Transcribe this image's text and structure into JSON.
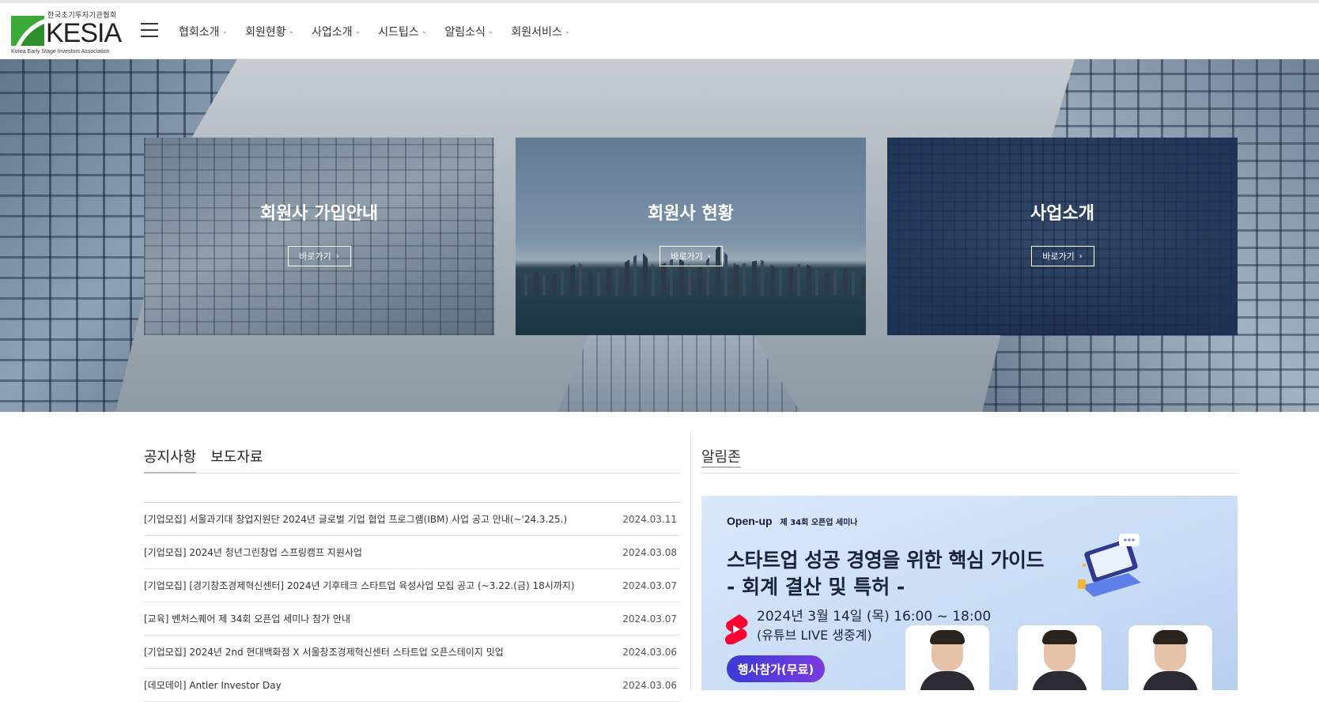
{
  "header": {
    "logo_kor": "한국초기투자기관협회",
    "logo_word": "KESIA",
    "logo_eng": "Korea Early Stage Investors Association",
    "nav": [
      {
        "label": "협회소개"
      },
      {
        "label": "회원현황"
      },
      {
        "label": "사업소개"
      },
      {
        "label": "시드팁스"
      },
      {
        "label": "알림소식"
      },
      {
        "label": "회원서비스"
      }
    ]
  },
  "hero": {
    "cards": [
      {
        "title": "회원사 가입안내",
        "button": "바로가기"
      },
      {
        "title": "회원사 현황",
        "button": "바로가기"
      },
      {
        "title": "사업소개",
        "button": "바로가기"
      }
    ]
  },
  "board": {
    "tabs": [
      {
        "label": "공지사항",
        "active": true
      },
      {
        "label": "보도자료",
        "active": false
      }
    ],
    "rows": [
      {
        "title": "[기업모집] 서울과기대 창업지원단 2024년 글로벌 기업 협업 프로그램(IBM) 사업 공고 안내(~'24.3.25.)",
        "date": "2024.03.11"
      },
      {
        "title": "[기업모집] 2024년 청년그린창업 스프링캠프 지원사업",
        "date": "2024.03.08"
      },
      {
        "title": "[기업모집] [경기창조경제혁신센터] 2024년 기후테크 스타트업 육성사업 모집 공고 (~3.22.(금) 18시까지)",
        "date": "2024.03.07"
      },
      {
        "title": "[교육] 벤처스퀘어 제 34회 오픈업 세미나 참가 안내",
        "date": "2024.03.07"
      },
      {
        "title": "[기업모집] 2024년 2nd 현대백화점 X 서울창조경제혁신센터 스타트업 오픈스테이지 밋업",
        "date": "2024.03.06"
      },
      {
        "title": "[데모데이] Antler Investor Day",
        "date": "2024.03.06"
      }
    ]
  },
  "alim": {
    "title": "알림존",
    "banner": {
      "brand": "Open-up",
      "brand_sub": "제 34회 오픈업 세미나",
      "headline1": "스타트업 성공 경영을 위한 핵심 가이드",
      "headline2": "- 회계 결산 및 특허 -",
      "date": "2024년 3월 14일 (목) 16:00 ~ 18:00",
      "live": "(유튜브 LIVE 생중계)",
      "cta": "행사참가(무료)"
    }
  }
}
